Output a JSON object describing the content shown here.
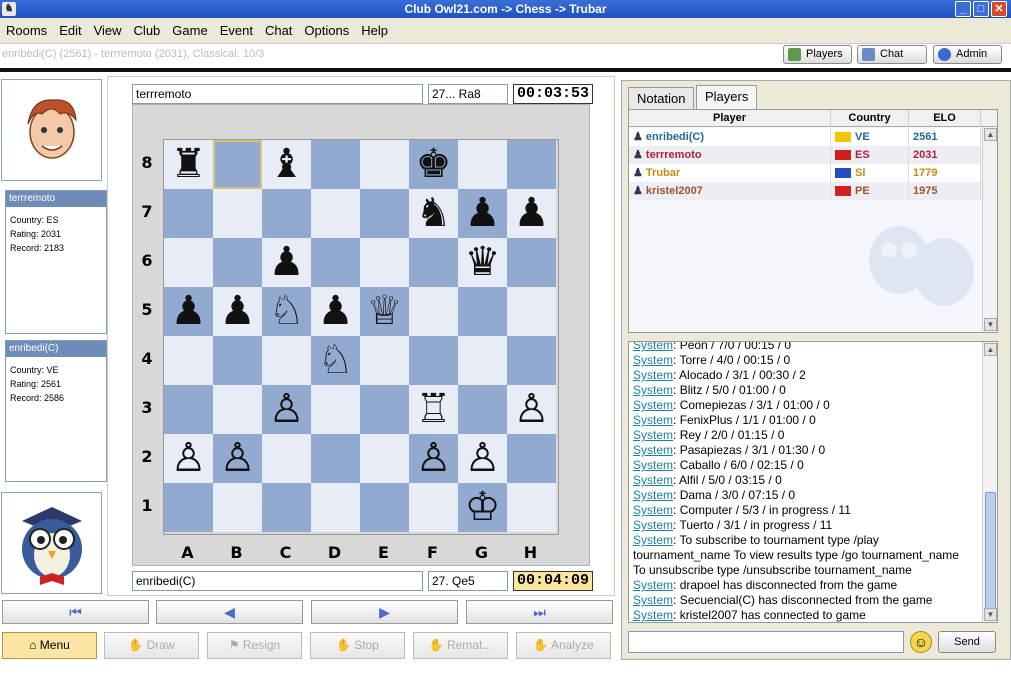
{
  "window": {
    "title": "Club Owl21.com -> Chess -> Trubar"
  },
  "menu": [
    "Rooms",
    "Edit",
    "View",
    "Club",
    "Game",
    "Event",
    "Chat",
    "Options",
    "Help"
  ],
  "status": {
    "game_info": "enribedi(C) (2561) - terrremoto (2031), Classical: 10/3"
  },
  "toolbar": {
    "players": "Players",
    "chat": "Chat",
    "admin": "Admin"
  },
  "top_player": {
    "name": "terrremoto",
    "last_move": "27... Ra8",
    "clock": "00:03:53",
    "card_title": "terrremoto",
    "country": "Country: ES",
    "rating": "Rating: 2031",
    "record": "Record: 2183"
  },
  "bottom_player": {
    "name": "enribedi(C)",
    "last_move": "27. Qe5",
    "clock": "00:04:09",
    "card_title": "enribedi(C)",
    "country": "Country: VE",
    "rating": "Rating: 2561",
    "record": "Record: 2586"
  },
  "board": {
    "ranks": [
      "8",
      "7",
      "6",
      "5",
      "4",
      "3",
      "2",
      "1"
    ],
    "files": [
      "A",
      "B",
      "C",
      "D",
      "E",
      "F",
      "G",
      "H"
    ],
    "pieces": [
      {
        "sq": "a8",
        "g": "♜",
        "c": "b"
      },
      {
        "sq": "c8",
        "g": "♝",
        "c": "b"
      },
      {
        "sq": "f8",
        "g": "♚",
        "c": "b"
      },
      {
        "sq": "f7",
        "g": "♞",
        "c": "b"
      },
      {
        "sq": "g7",
        "g": "♟",
        "c": "b"
      },
      {
        "sq": "h7",
        "g": "♟",
        "c": "b"
      },
      {
        "sq": "c6",
        "g": "♟",
        "c": "b"
      },
      {
        "sq": "g6",
        "g": "♛",
        "c": "b"
      },
      {
        "sq": "a5",
        "g": "♟",
        "c": "b"
      },
      {
        "sq": "b5",
        "g": "♟",
        "c": "b"
      },
      {
        "sq": "c5",
        "g": "♘",
        "c": "w"
      },
      {
        "sq": "d5",
        "g": "♟",
        "c": "b"
      },
      {
        "sq": "e5",
        "g": "♕",
        "c": "w"
      },
      {
        "sq": "d4",
        "g": "♘",
        "c": "w"
      },
      {
        "sq": "c3",
        "g": "♙",
        "c": "w"
      },
      {
        "sq": "f3",
        "g": "♖",
        "c": "w"
      },
      {
        "sq": "h3",
        "g": "♙",
        "c": "w"
      },
      {
        "sq": "a2",
        "g": "♙",
        "c": "w"
      },
      {
        "sq": "b2",
        "g": "♙",
        "c": "w"
      },
      {
        "sq": "f2",
        "g": "♙",
        "c": "w"
      },
      {
        "sq": "g2",
        "g": "♙",
        "c": "w"
      },
      {
        "sq": "g1",
        "g": "♔",
        "c": "w"
      }
    ],
    "highlight": "b8",
    "light_color": "#e8ecf6",
    "dark_color": "#93aad0"
  },
  "nav": [
    "⏮",
    "◀",
    "▶",
    "⏭"
  ],
  "actions": {
    "menu": "Menu",
    "draw": "Draw",
    "resign": "Resign",
    "stop": "Stop",
    "rematch": "Remat...",
    "analyze": "Analyze"
  },
  "tabs": {
    "notation": "Notation",
    "players": "Players"
  },
  "players_table": {
    "headers": {
      "player": "Player",
      "country": "Country",
      "elo": "ELO"
    },
    "rows": [
      {
        "name": "enribedi(C)",
        "country": "VE",
        "elo": "2561",
        "color": "#1b6a9a",
        "flag": "#f2c500"
      },
      {
        "name": "terrremoto",
        "country": "ES",
        "elo": "2031",
        "color": "#b0223a",
        "flag": "#d0201a"
      },
      {
        "name": "Trubar",
        "country": "SI",
        "elo": "1779",
        "color": "#c88a10",
        "flag": "#2050c0"
      },
      {
        "name": "kristel2007",
        "country": "PE",
        "elo": "1975",
        "color": "#a0522d",
        "flag": "#d02020"
      }
    ]
  },
  "chat": {
    "lines": [
      {
        "sys": "System",
        "text": "Peon / 7/0 / 00:15 / 0"
      },
      {
        "sys": "System",
        "text": "Torre / 4/0 / 00:15 / 0"
      },
      {
        "sys": "System",
        "text": "Alocado / 3/1 / 00:30 / 2"
      },
      {
        "sys": "System",
        "text": "Blitz / 5/0 / 01:00 / 0"
      },
      {
        "sys": "System",
        "text": "Comepiezas / 3/1 / 01:00 / 0"
      },
      {
        "sys": "System",
        "text": "FenixPlus / 1/1 / 01:00 / 0"
      },
      {
        "sys": "System",
        "text": "Rey / 2/0 / 01:15 / 0"
      },
      {
        "sys": "System",
        "text": "Pasapiezas / 3/1 / 01:30 / 0"
      },
      {
        "sys": "System",
        "text": "Caballo / 6/0 / 02:15 / 0"
      },
      {
        "sys": "System",
        "text": "Alfil / 5/0 / 03:15 / 0"
      },
      {
        "sys": "System",
        "text": "Dama / 3/0 / 07:15 / 0"
      },
      {
        "sys": "System",
        "text": "Computer / 5/3 / in progress / 11"
      },
      {
        "sys": "System",
        "text": "Tuerto / 3/1 / in progress / 11"
      },
      {
        "sys": "System",
        "text": "To subscribe to tournament type  /play"
      },
      {
        "sys": "",
        "text": "tournament_name  To view results type  /go tournament_name"
      },
      {
        "sys": "",
        "text": " To unsubscribe type  /unsubscribe tournament_name"
      },
      {
        "sys": "System",
        "text": "drapoel has disconnected from the game"
      },
      {
        "sys": "System",
        "text": "Secuencial(C) has disconnected from the game"
      },
      {
        "sys": "System",
        "text": "kristel2007 has connected to game"
      }
    ],
    "send": "Send"
  }
}
